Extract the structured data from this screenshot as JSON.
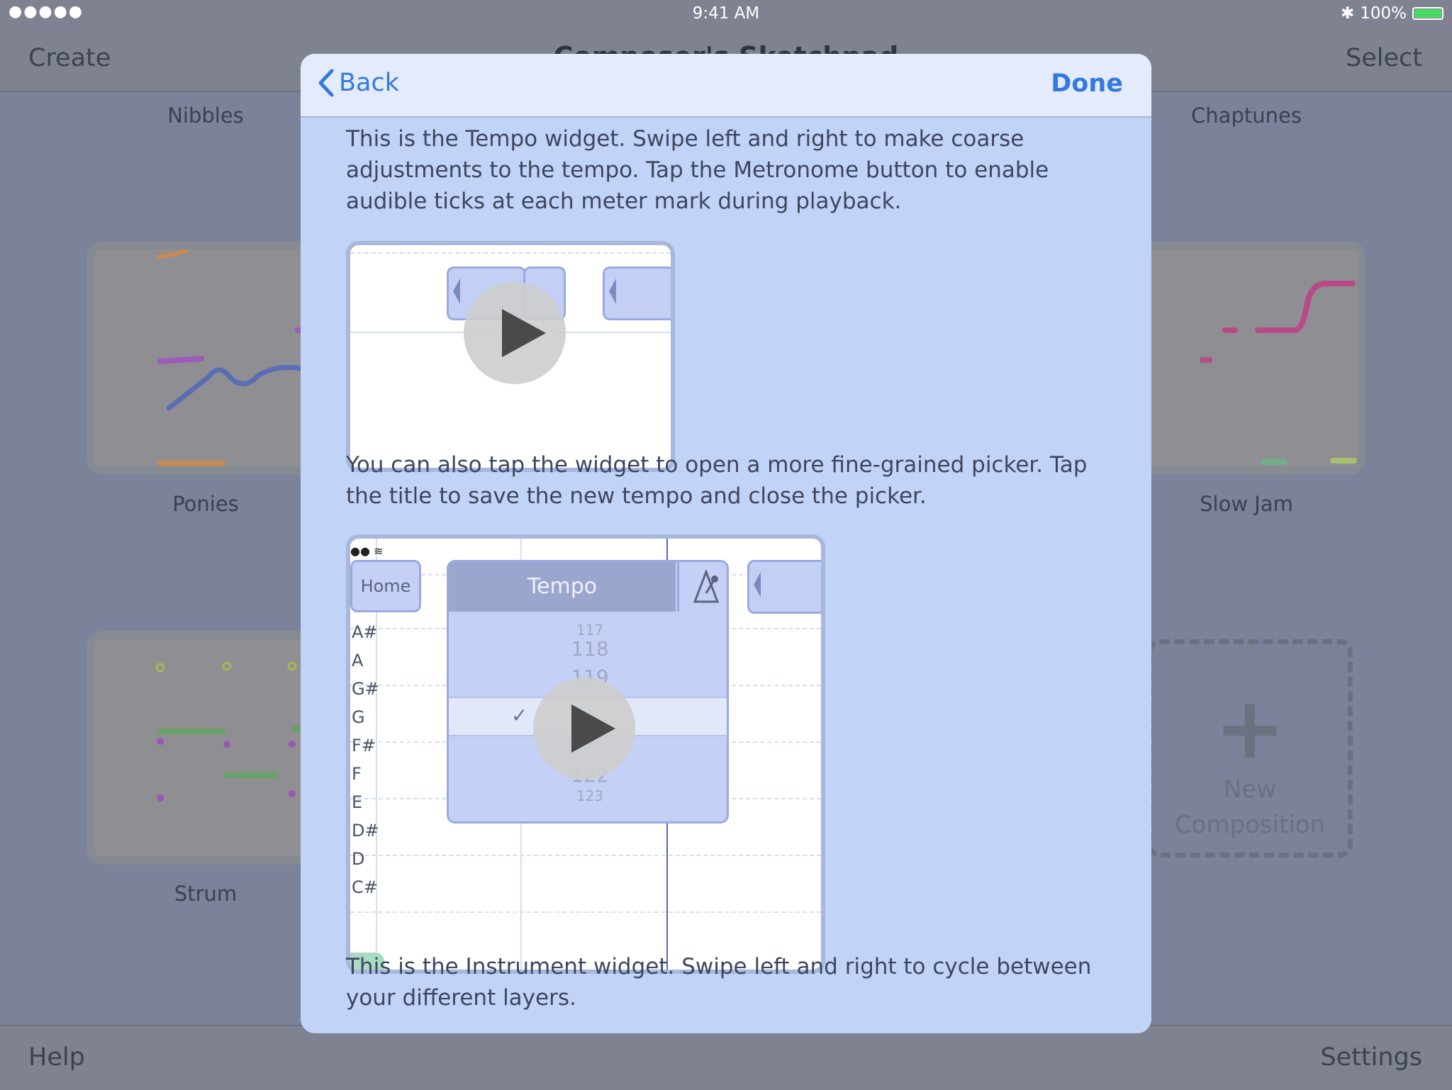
{
  "status_bar": {
    "signal": "●●●●●",
    "time": "9:41 AM",
    "battery_percent": "100%",
    "battery_level": 1.0
  },
  "nav": {
    "create_label": "Create",
    "title": "Composer's Sketchpad",
    "select_label": "Select"
  },
  "compositions": [
    {
      "name": "Nibbles"
    },
    {
      "name": "Chaptunes"
    },
    {
      "name": "Ponies"
    },
    {
      "name": "Slow Jam"
    },
    {
      "name": "Strum"
    }
  ],
  "new_composition": {
    "line1": "New",
    "line2": "Composition"
  },
  "toolbar": {
    "help_label": "Help",
    "settings_label": "Settings"
  },
  "modal": {
    "back_label": "Back",
    "done_label": "Done",
    "para1": "This is the Tempo widget. Swipe left and right to make coarse adjustments to the tempo. Tap the Metronome button to enable audible ticks at each meter mark during playback.",
    "para2": "You can also tap the widget to open a more fine-grained picker. Tap the title to save the new tempo and close the picker.",
    "para3": "This is the Instrument widget. Swipe left and right to cycle between your different layers.",
    "video2": {
      "home_label": "Home",
      "picker_title": "Tempo",
      "picker_values": [
        "117",
        "118",
        "119",
        "122",
        "123"
      ],
      "checkmark": "✓",
      "key_labels": [
        "A#",
        "A",
        "G#",
        "G",
        "F#",
        "F",
        "E",
        "D#",
        "D",
        "C#"
      ]
    }
  }
}
